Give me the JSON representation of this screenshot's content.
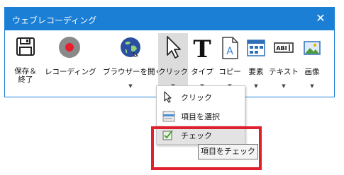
{
  "window": {
    "title": "ウェブレコーディング",
    "close_glyph": "✕",
    "accent_color": "#1b7fd6"
  },
  "toolbar": {
    "items": [
      {
        "label_line1": "保存＆",
        "label_line2": "終了",
        "icon": "floppy-disk-icon"
      },
      {
        "label": "レコーディング",
        "icon": "record-icon"
      },
      {
        "label": "ブラウザーを開く",
        "icon": "globe-icon"
      },
      {
        "label": "クリック",
        "icon": "cursor-icon"
      },
      {
        "label": "タイプ",
        "icon": "letter-t-icon"
      },
      {
        "label": "コピー",
        "icon": "copy-document-icon"
      },
      {
        "label": "要素",
        "icon": "element-grid-icon"
      },
      {
        "label": "テキスト",
        "icon": "text-field-icon"
      },
      {
        "label": "画像",
        "icon": "image-icon"
      }
    ],
    "caret_glyph": "▼"
  },
  "dropdown": {
    "items": [
      {
        "label": "クリック",
        "icon": "cursor-icon"
      },
      {
        "label": "項目を選択",
        "icon": "list-select-icon"
      },
      {
        "label": "チェック",
        "icon": "checkbox-icon",
        "hovered": true
      }
    ]
  },
  "tooltip": {
    "text": "項目をチェック"
  },
  "highlight_color": "#e0202c"
}
